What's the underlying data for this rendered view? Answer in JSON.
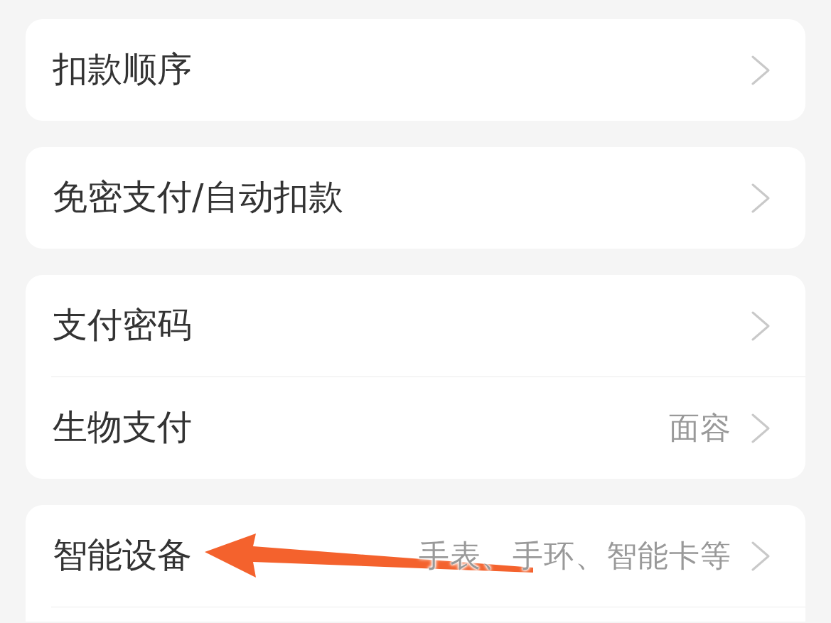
{
  "groups": [
    {
      "items": [
        {
          "label": "扣款顺序"
        }
      ]
    },
    {
      "items": [
        {
          "label": "免密支付/自动扣款"
        }
      ]
    },
    {
      "items": [
        {
          "label": "支付密码"
        },
        {
          "label": "生物支付",
          "value": "面容"
        }
      ]
    },
    {
      "items": [
        {
          "label": "智能设备",
          "value": "手表、手环、智能卡等"
        }
      ],
      "continues_below": true
    }
  ]
}
